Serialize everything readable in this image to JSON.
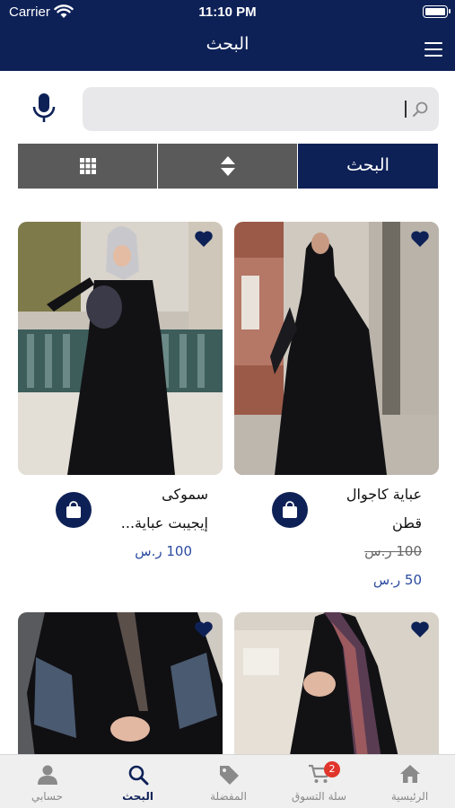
{
  "status_bar": {
    "carrier": "Carrier",
    "time": "11:10 PM"
  },
  "nav": {
    "title": "البحث"
  },
  "search": {
    "value": "",
    "placeholder": ""
  },
  "segments": {
    "search_label": "البحث"
  },
  "products": [
    {
      "name_line1": "عباية كاجوال",
      "name_line2": "قطن",
      "old_price": "100 ر.س",
      "price": "50 ر.س"
    },
    {
      "name_line1": "سموكى",
      "name_line2": "إيجيبت عباية...",
      "price": "100 ر.س"
    }
  ],
  "tabs": {
    "home": "الرئيسية",
    "cart": "سلة التسوق",
    "cart_badge": "2",
    "favorites": "المفضلة",
    "search": "البحث",
    "account": "حسابي"
  },
  "colors": {
    "primary": "#0e2157",
    "segment_gray": "#5a5a5a",
    "price_blue": "#2b4aa0",
    "badge_red": "#e0352b"
  }
}
